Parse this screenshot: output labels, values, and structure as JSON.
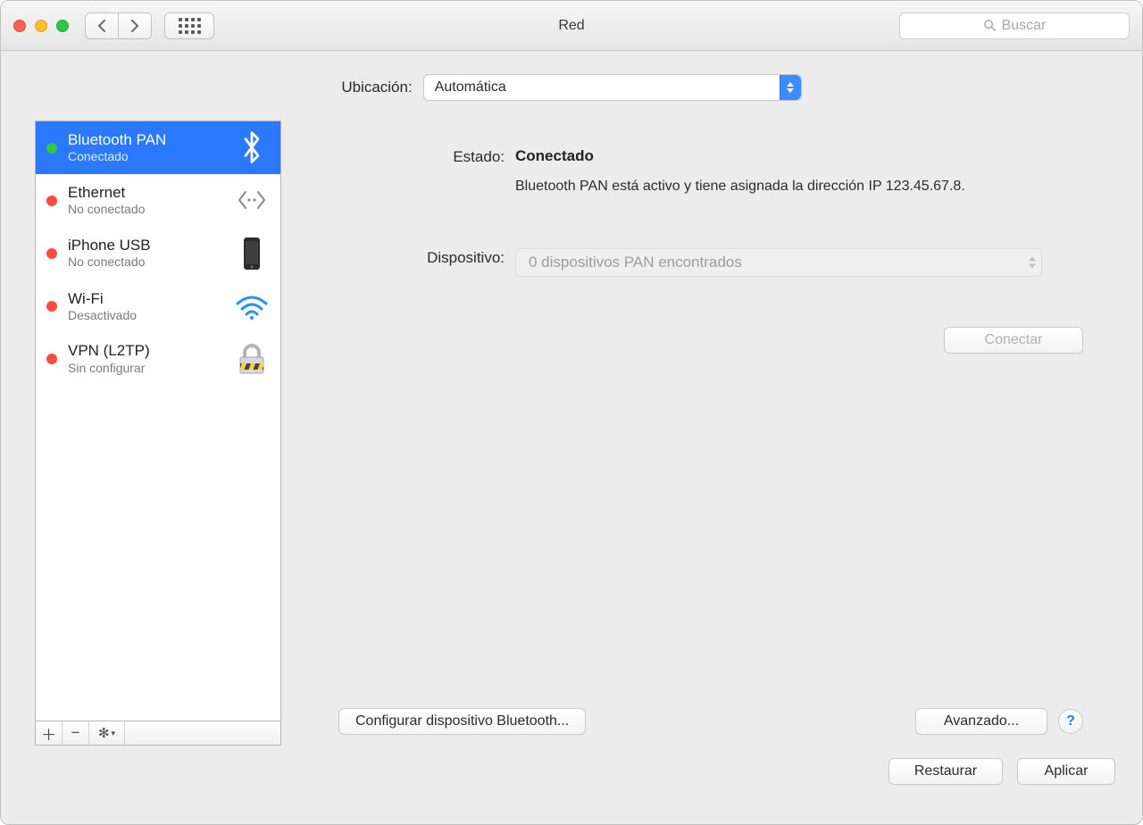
{
  "window": {
    "title": "Red",
    "search_placeholder": "Buscar"
  },
  "location": {
    "label": "Ubicación:",
    "value": "Automática"
  },
  "services": [
    {
      "name": "Bluetooth PAN",
      "sub": "Conectado",
      "status": "green",
      "icon": "bt",
      "selected": true
    },
    {
      "name": "Ethernet",
      "sub": "No conectado",
      "status": "red",
      "icon": "eth",
      "selected": false
    },
    {
      "name": "iPhone USB",
      "sub": "No conectado",
      "status": "red",
      "icon": "phone",
      "selected": false
    },
    {
      "name": "Wi-Fi",
      "sub": "Desactivado",
      "status": "red",
      "icon": "wifi",
      "selected": false
    },
    {
      "name": "VPN (L2TP)",
      "sub": "Sin configurar",
      "status": "red",
      "icon": "lock",
      "selected": false
    }
  ],
  "detail": {
    "status_label": "Estado:",
    "status_value": "Conectado",
    "status_description": "Bluetooth PAN está activo y tiene asignada la dirección IP 123.45.67.8.",
    "device_label": "Dispositivo:",
    "device_value": "0 dispositivos PAN encontrados",
    "connect_btn": "Conectar",
    "config_bt_btn": "Configurar dispositivo Bluetooth...",
    "advanced_btn": "Avanzado..."
  },
  "footer": {
    "revert_btn": "Restaurar",
    "apply_btn": "Aplicar"
  }
}
